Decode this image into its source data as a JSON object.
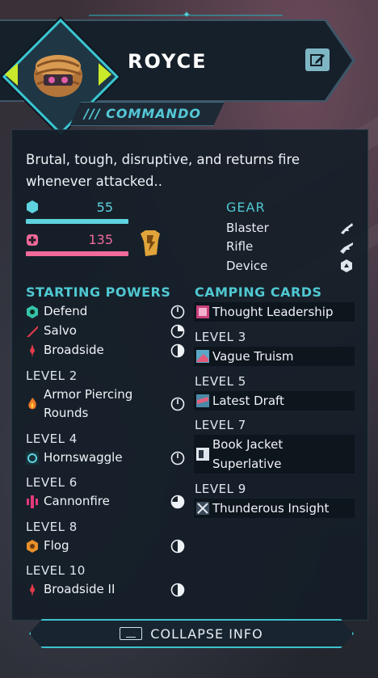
{
  "character": {
    "name": "ROYCE",
    "class_label": "/// COMMANDO",
    "description": "Brutal, tough, disruptive, and returns fire whenever attacked.."
  },
  "stats": {
    "shield_value": "55",
    "health_value": "135"
  },
  "gear": {
    "title": "GEAR",
    "items": [
      {
        "label": "Blaster",
        "icon": "blaster-icon"
      },
      {
        "label": "Rifle",
        "icon": "rifle-icon"
      },
      {
        "label": "Device",
        "icon": "device-icon"
      }
    ]
  },
  "powers": {
    "title": "STARTING POWERS",
    "starting": [
      {
        "name": "Defend",
        "icon": "defend-icon",
        "timer": "timer-full"
      },
      {
        "name": "Salvo",
        "icon": "salvo-icon",
        "timer": "timer-quarter"
      },
      {
        "name": "Broadside",
        "icon": "broadside-icon",
        "timer": "timer-half"
      }
    ],
    "level2_label": "LEVEL 2",
    "level2_name_line1": "Armor Piercing",
    "level2_name_line2": "Rounds",
    "level4_label": "LEVEL 4",
    "level4_name": "Hornswaggle",
    "level6_label": "LEVEL 6",
    "level6_name": "Cannonfire",
    "level8_label": "LEVEL 8",
    "level8_name": "Flog",
    "level10_label": "LEVEL 10",
    "level10_name": "Broadside II"
  },
  "cards": {
    "title": "CAMPING CARDS",
    "starting": "Thought Leadership",
    "level3_label": "LEVEL 3",
    "level3_name": "Vague Truism",
    "level5_label": "LEVEL 5",
    "level5_name": "Latest Draft",
    "level7_label": "LEVEL 7",
    "level7_name_line1": "Book Jacket",
    "level7_name_line2": "Superlative",
    "level9_label": "LEVEL 9",
    "level9_name": "Thunderous Insight"
  },
  "footer": {
    "collapse_label": "COLLAPSE INFO"
  },
  "colors": {
    "accent": "#4fc8d2",
    "shield": "#5fd3e0",
    "health": "#f06a9a",
    "selector_arrows": "#c9ea2a",
    "armor": "#e0a43a"
  }
}
